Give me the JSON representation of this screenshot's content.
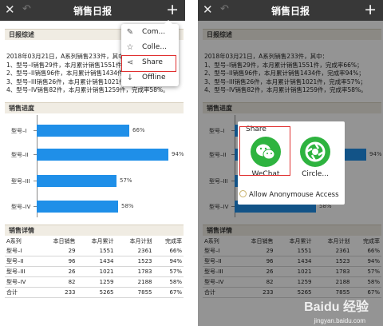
{
  "app": {
    "title": "销售日报",
    "close_glyph": "✕",
    "back_glyph": "↶",
    "plus_glyph": "+"
  },
  "sections": {
    "summary": "日报综述",
    "progress": "销售进度",
    "detail": "销售详情"
  },
  "summary_lines": [
    "2018年03月21日，A系列销售233件，其中：",
    "1、型号–I销售29件，本月累计销售1551件，完成率66%；",
    "2、型号–II销售96件，本月累计销售1434件，完成率94%；",
    "3、型号–III销售26件，本月累计销售1021件，完成率57%；",
    "4、型号–IV销售82件，本月累计销售1259件，完成率58%。"
  ],
  "progress_bars": [
    {
      "label": "型号–I",
      "value": 66,
      "value_label": "66%"
    },
    {
      "label": "型号–II",
      "value": 94,
      "value_label": "94%"
    },
    {
      "label": "型号–III",
      "value": 57,
      "value_label": "57%"
    },
    {
      "label": "型号–IV",
      "value": 58,
      "value_label": "58%"
    }
  ],
  "bar_color": "#1f8fe8",
  "detail_table": {
    "headers": [
      "A系列",
      "本日销售",
      "本月累计",
      "本月计划",
      "完成率"
    ],
    "rows": [
      [
        "型号–I",
        "29",
        "1551",
        "2361",
        "66%"
      ],
      [
        "型号–II",
        "96",
        "1434",
        "1523",
        "94%"
      ],
      [
        "型号–III",
        "26",
        "1021",
        "1783",
        "57%"
      ],
      [
        "型号–IV",
        "82",
        "1259",
        "2188",
        "58%"
      ],
      [
        "合计",
        "233",
        "5265",
        "7855",
        "67%"
      ]
    ]
  },
  "menu": {
    "items": [
      {
        "label": "Com...",
        "icon": "pencil-icon",
        "glyph": "✎"
      },
      {
        "label": "Colle...",
        "icon": "star-icon",
        "glyph": "☆"
      },
      {
        "label": "Share",
        "icon": "share-icon",
        "glyph": "⋖"
      },
      {
        "label": "Offline",
        "icon": "download-icon",
        "glyph": "↓"
      }
    ],
    "highlighted": "Share"
  },
  "share_sheet": {
    "title": "Share",
    "apps": [
      {
        "label": "WeChat",
        "icon": "wechat-icon",
        "color": "#2eb33f"
      },
      {
        "label": "Circle...",
        "icon": "moments-icon",
        "color": "#2eb33f"
      }
    ],
    "anonymous_label": "Allow Anonymouse Access"
  },
  "watermark": {
    "brand": "Baidu 经验",
    "url": "jingyan.baidu.com"
  },
  "highlight_color": "#e03030"
}
